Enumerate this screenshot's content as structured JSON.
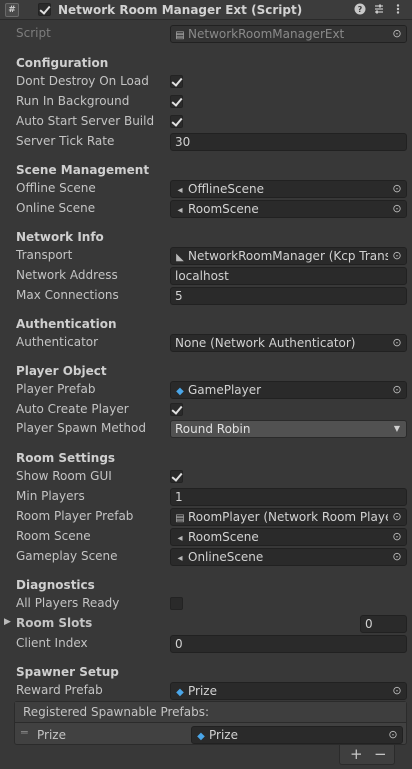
{
  "header": {
    "title": "Network Room Manager Ext (Script)",
    "script_icon": "#"
  },
  "script_row": {
    "label": "Script",
    "value": "NetworkRoomManagerExt"
  },
  "configuration": {
    "title": "Configuration",
    "dont_destroy_label": "Dont Destroy On Load",
    "dont_destroy": true,
    "run_bg_label": "Run In Background",
    "run_bg": true,
    "auto_start_label": "Auto Start Server Build",
    "auto_start": true,
    "tick_rate_label": "Server Tick Rate",
    "tick_rate": "30"
  },
  "scene_management": {
    "title": "Scene Management",
    "offline_label": "Offline Scene",
    "offline_value": "OfflineScene",
    "online_label": "Online Scene",
    "online_value": "RoomScene"
  },
  "network_info": {
    "title": "Network Info",
    "transport_label": "Transport",
    "transport_value": "NetworkRoomManager (Kcp Transport)",
    "address_label": "Network Address",
    "address_value": "localhost",
    "max_conn_label": "Max Connections",
    "max_conn_value": "5"
  },
  "authentication": {
    "title": "Authentication",
    "auth_label": "Authenticator",
    "auth_value": "None (Network Authenticator)"
  },
  "player_object": {
    "title": "Player Object",
    "prefab_label": "Player Prefab",
    "prefab_value": "GamePlayer",
    "auto_create_label": "Auto Create Player",
    "auto_create": true,
    "spawn_method_label": "Player Spawn Method",
    "spawn_method_value": "Round Robin"
  },
  "room_settings": {
    "title": "Room Settings",
    "show_gui_label": "Show Room GUI",
    "show_gui": true,
    "min_players_label": "Min Players",
    "min_players_value": "1",
    "room_player_prefab_label": "Room Player Prefab",
    "room_player_prefab_value": "RoomPlayer (Network Room Player Ext)",
    "room_scene_label": "Room Scene",
    "room_scene_value": "RoomScene",
    "gameplay_scene_label": "Gameplay Scene",
    "gameplay_scene_value": "OnlineScene"
  },
  "diagnostics": {
    "title": "Diagnostics",
    "all_ready_label": "All Players Ready",
    "all_ready": false,
    "room_slots_label": "Room Slots",
    "room_slots_value": "0",
    "client_index_label": "Client Index",
    "client_index_value": "0"
  },
  "spawner_setup": {
    "title": "Spawner Setup",
    "reward_label": "Reward Prefab",
    "reward_value": "Prize",
    "list_title": "Registered Spawnable Prefabs:",
    "list_items": [
      {
        "label": "Prize",
        "value": "Prize"
      }
    ],
    "add_label": "+",
    "remove_label": "−"
  },
  "icons": {
    "help": "help-icon",
    "presets": "presets-icon",
    "menu": "kebab-menu-icon",
    "scene": "scene-asset-icon",
    "prefab": "prefab-icon",
    "object_picker": "object-picker-icon"
  }
}
